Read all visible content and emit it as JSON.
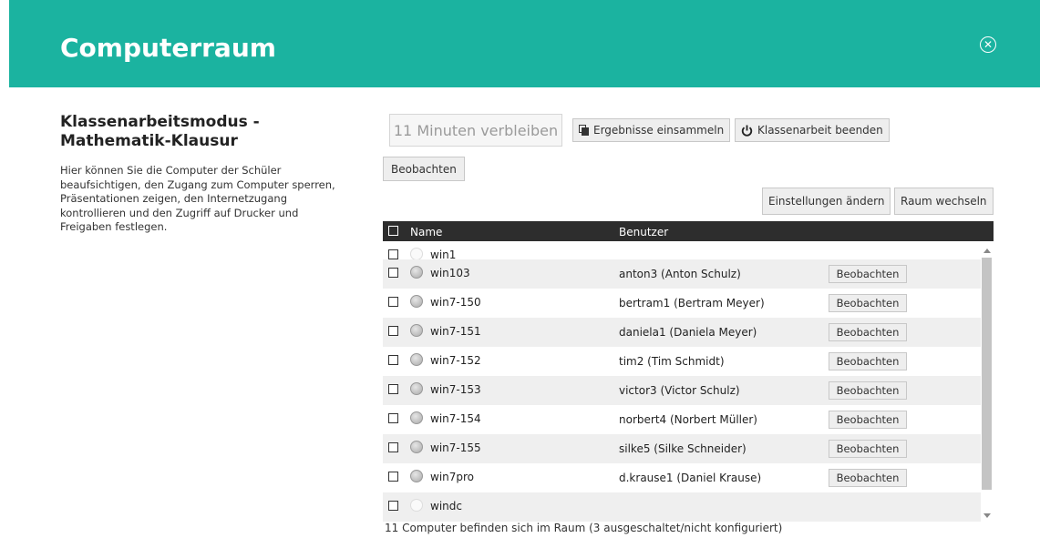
{
  "header": {
    "title": "Computerraum",
    "close_icon": "close-circle-icon",
    "color": "#1bb3a0"
  },
  "exam": {
    "title": "Klassenarbeitsmodus - Mathematik-Klausur",
    "description": "Hier können Sie die Computer der Schüler beaufsichtigen, den Zugang zum Computer sperren, Präsentationen zeigen, den Internetzugang kontrollieren und den Zugriff auf Drucker und Freigaben festlegen."
  },
  "toolbar": {
    "timer_label": "11 Minuten verbleiben",
    "collect_label": "Ergebnisse einsammeln",
    "collect_icon": "copy-icon",
    "end_label": "Klassenarbeit beenden",
    "end_icon": "power-icon",
    "observe_label": "Beobachten",
    "settings_label": "Einstellungen ändern",
    "change_room_label": "Raum wechseln"
  },
  "table": {
    "columns": [
      "Name",
      "Benutzer"
    ],
    "rows": [
      {
        "name": "win1",
        "user": "",
        "status": "off",
        "action": ""
      },
      {
        "name": "win103",
        "user": "anton3 (Anton Schulz)",
        "status": "on",
        "action": "Beobachten"
      },
      {
        "name": "win7-150",
        "user": "bertram1 (Bertram Meyer)",
        "status": "on",
        "action": "Beobachten"
      },
      {
        "name": "win7-151",
        "user": "daniela1 (Daniela Meyer)",
        "status": "on",
        "action": "Beobachten"
      },
      {
        "name": "win7-152",
        "user": "tim2 (Tim Schmidt)",
        "status": "on",
        "action": "Beobachten"
      },
      {
        "name": "win7-153",
        "user": "victor3 (Victor Schulz)",
        "status": "on",
        "action": "Beobachten"
      },
      {
        "name": "win7-154",
        "user": "norbert4 (Norbert Müller)",
        "status": "on",
        "action": "Beobachten"
      },
      {
        "name": "win7-155",
        "user": "silke5 (Silke Schneider)",
        "status": "on",
        "action": "Beobachten"
      },
      {
        "name": "win7pro",
        "user": "d.krause1 (Daniel Krause)",
        "status": "on",
        "action": "Beobachten"
      },
      {
        "name": "windc",
        "user": "",
        "status": "off",
        "action": ""
      }
    ],
    "footer": "11 Computer befinden sich im Raum (3 ausgeschaltet/nicht konfiguriert)"
  }
}
